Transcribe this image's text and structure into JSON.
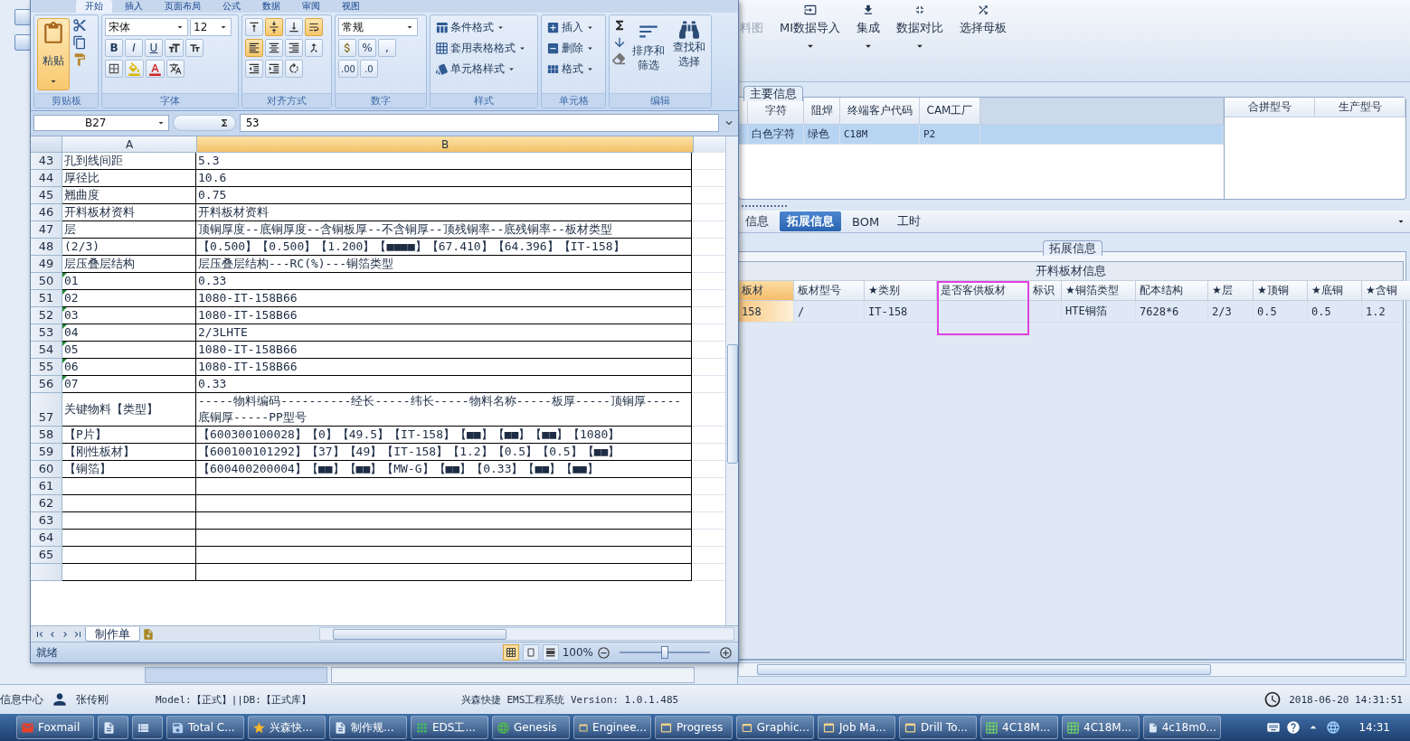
{
  "excel": {
    "ribbon_tabs": [
      {
        "label": "开始",
        "selected": true
      },
      {
        "label": "插入",
        "selected": false
      },
      {
        "label": "页面布局",
        "selected": false
      },
      {
        "label": "公式",
        "selected": false
      },
      {
        "label": "数据",
        "selected": false
      },
      {
        "label": "审阅",
        "selected": false
      },
      {
        "label": "视图",
        "selected": false
      }
    ],
    "clipboard": {
      "paste": "粘贴",
      "group": "剪贴板"
    },
    "font": {
      "name": "宋体",
      "size": "12",
      "bold": "B",
      "italic": "I",
      "underline": "U",
      "group": "字体"
    },
    "alignment": {
      "group": "对齐方式",
      "buttons": [
        {
          "kind": "top",
          "selected": false
        },
        {
          "kind": "middle",
          "selected": true
        },
        {
          "kind": "bottom",
          "selected": false
        },
        {
          "kind": "wrap",
          "selected": true
        },
        {
          "kind": "left",
          "selected": true
        },
        {
          "kind": "center",
          "selected": false
        },
        {
          "kind": "right",
          "selected": false
        },
        {
          "kind": "merge",
          "selected": false
        },
        {
          "kind": "outdent",
          "selected": false
        },
        {
          "kind": "indent",
          "selected": false
        },
        {
          "kind": "orient",
          "selected": false
        }
      ]
    },
    "number": {
      "format": "常规",
      "percent": "%",
      "comma": ",",
      "decimals": [
        ".00",
        ".0"
      ],
      "group": "数字"
    },
    "styles": {
      "items": [
        "条件格式",
        "套用表格格式",
        "单元格样式"
      ],
      "group": "样式"
    },
    "cells": {
      "items": [
        "插入",
        "删除",
        "格式"
      ],
      "group": "单元格"
    },
    "editing": {
      "sort": "排序和筛选",
      "find": "查找和选择",
      "group": "编辑"
    },
    "formula": {
      "cell": "B27",
      "value": "53"
    },
    "columns": [
      "A",
      "B"
    ],
    "rows": [
      {
        "num": "43",
        "a": "孔到线间距",
        "b": "5.3",
        "flag": false
      },
      {
        "num": "44",
        "a": "厚径比",
        "b": "10.6",
        "flag": false
      },
      {
        "num": "45",
        "a": "翘曲度",
        "b": "0.75",
        "flag": false
      },
      {
        "num": "46",
        "a": "开料板材资料",
        "b": "开料板材资料",
        "flag": false
      },
      {
        "num": "47",
        "a": "层",
        "b": "顶铜厚度--底铜厚度--含铜板厚--不含铜厚--顶残铜率--底残铜率--板材类型",
        "flag": false
      },
      {
        "num": "48",
        "a": "(2/3)",
        "b": "【0.500】【0.500】【1.200】【■■■■】【67.410】【64.396】【IT-158】",
        "flag": false
      },
      {
        "num": "49",
        "a": "层压叠层结构",
        "b": "层压叠层结构---RC(%)---铜箔类型",
        "flag": false
      },
      {
        "num": "50",
        "a": "01",
        "b": "0.33",
        "flag": true
      },
      {
        "num": "51",
        "a": "02",
        "b": "1080-IT-158B66",
        "flag": true
      },
      {
        "num": "52",
        "a": "03",
        "b": "1080-IT-158B66",
        "flag": true
      },
      {
        "num": "53",
        "a": "04",
        "b": "2/3LHTE",
        "flag": true
      },
      {
        "num": "54",
        "a": "05",
        "b": "1080-IT-158B66",
        "flag": true
      },
      {
        "num": "55",
        "a": "06",
        "b": "1080-IT-158B66",
        "flag": true
      },
      {
        "num": "56",
        "a": "07",
        "b": "0.33",
        "flag": true
      },
      {
        "num": "57",
        "a": "关键物料【类型】",
        "b": "-----物料编码----------经长-----纬长-----物料名称-----板厚-----顶铜厚-----底铜厚-----PP型号",
        "flag": false
      },
      {
        "num": "58",
        "a": "【P片】",
        "b": "【600300100028】【0】【49.5】【IT-158】【■■】【■■】【■■】【1080】",
        "flag": false
      },
      {
        "num": "59",
        "a": "【刚性板材】",
        "b": "【600100101292】【37】【49】【IT-158】【1.2】【0.5】【0.5】【■■】",
        "flag": false
      },
      {
        "num": "60",
        "a": "【铜箔】",
        "b": "【600400200004】【■■】【■■】【MW-G】【■■】【0.33】【■■】【■■】",
        "flag": false
      },
      {
        "num": "61",
        "a": null,
        "b": null,
        "flag": false
      },
      {
        "num": "62",
        "a": null,
        "b": null,
        "flag": false
      },
      {
        "num": "63",
        "a": null,
        "b": null,
        "flag": false
      },
      {
        "num": "64",
        "a": null,
        "b": null,
        "flag": false
      },
      {
        "num": "65",
        "a": null,
        "b": null,
        "flag": false
      }
    ],
    "sheet_tab": "制作单",
    "status": "就绪",
    "zoom": {
      "label": "100%",
      "level": 0.5
    }
  },
  "ems": {
    "toolbar": [
      {
        "label": "料图",
        "kind": "plain",
        "dropdown": false
      },
      {
        "label": "MI数据导入",
        "kind": "import",
        "dropdown": true
      },
      {
        "label": "集成",
        "kind": "download",
        "dropdown": true
      },
      {
        "label": "数据对比",
        "kind": "compare",
        "dropdown": true
      },
      {
        "label": "选择母板",
        "kind": "shuffle",
        "dropdown": false
      }
    ],
    "main_info": {
      "title": "主要信息",
      "columns": [
        "字符",
        "阻焊",
        "终端客户代码",
        "CAM工厂"
      ],
      "rows": [
        {
          "cells": [
            "白色字符",
            "绿色",
            "C18M",
            "P2"
          ],
          "selected": true
        }
      ],
      "side_columns": [
        "合拼型号",
        "生产型号"
      ]
    },
    "detail_tabs": [
      {
        "label": "信息",
        "selected": false
      },
      {
        "label": "拓展信息",
        "selected": true
      },
      {
        "label": "BOM",
        "selected": false
      },
      {
        "label": "工时",
        "selected": false
      }
    ],
    "ext": {
      "title": "拓展信息",
      "table_title": "开料板材信息",
      "columns": [
        {
          "label": "板材",
          "selected": true,
          "highlight": false
        },
        {
          "label": "板材型号",
          "selected": false,
          "highlight": false
        },
        {
          "label": "★类别",
          "selected": false,
          "highlight": false
        },
        {
          "label": "是否客供板材",
          "selected": false,
          "highlight": true
        },
        {
          "label": "标识",
          "selected": false,
          "highlight": false
        },
        {
          "label": "★铜箔类型",
          "selected": false,
          "highlight": false
        },
        {
          "label": "配本结构",
          "selected": false,
          "highlight": false
        },
        {
          "label": "★层",
          "selected": false,
          "highlight": false
        },
        {
          "label": "★顶铜",
          "selected": false,
          "highlight": false
        },
        {
          "label": "★底铜",
          "selected": false,
          "highlight": false
        },
        {
          "label": "★含铜",
          "selected": false,
          "highlight": false
        }
      ],
      "rows": [
        {
          "cells": [
            "158",
            "/",
            "IT-158",
            null,
            null,
            "HTE铜箔",
            "7628*6",
            "2/3",
            "0.5",
            "0.5",
            "1.2"
          ]
        }
      ]
    },
    "status": {
      "module": "信息中心",
      "user": "张传刚",
      "env": "Model:【正式】||DB:【正式库】",
      "system": "兴森快捷 EMS工程系统 Version: 1.0.1.485",
      "datetime": "2018-06-20 14:31:51"
    }
  },
  "taskbar": {
    "items": [
      {
        "label": "Foxmail",
        "kind": "mail"
      },
      {
        "kind": "doc"
      },
      {
        "kind": "calc"
      },
      {
        "label": "Total C...",
        "kind": "save"
      },
      {
        "label": "兴森快...",
        "kind": "star"
      },
      {
        "label": "制作规...",
        "kind": "doc"
      },
      {
        "label": "EDS工...",
        "kind": "app"
      },
      {
        "label": "Genesis",
        "kind": "globe"
      },
      {
        "label": "Enginee...",
        "kind": "window"
      },
      {
        "label": "Progress",
        "kind": "window"
      },
      {
        "label": "Graphic...",
        "kind": "window"
      },
      {
        "label": "Job Ma...",
        "kind": "window"
      },
      {
        "label": "Drill To...",
        "kind": "window"
      },
      {
        "label": "4C18M...",
        "kind": "sheet"
      },
      {
        "label": "4C18M...",
        "kind": "sheet"
      },
      {
        "label": "4c18m0...",
        "kind": "file"
      }
    ],
    "clock": "14:31"
  }
}
